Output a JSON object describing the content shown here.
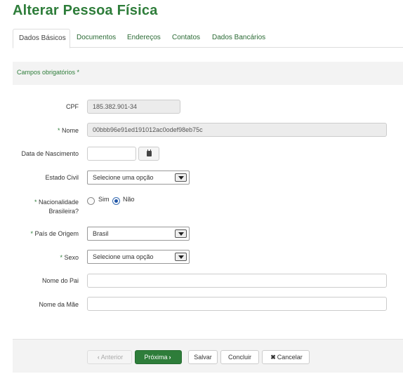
{
  "page": {
    "title": "Alterar Pessoa Física"
  },
  "tabs": [
    {
      "label": "Dados Básicos",
      "active": true
    },
    {
      "label": "Documentos"
    },
    {
      "label": "Endereços"
    },
    {
      "label": "Contatos"
    },
    {
      "label": "Dados Bancários"
    }
  ],
  "required_notice": "Campos obrigatórios *",
  "form": {
    "cpf": {
      "label": "CPF",
      "value": "185.382.901-34"
    },
    "nome": {
      "required_mark": "* ",
      "label": "Nome",
      "value": "00bbb96e91ed191012ac0odef98eb75c"
    },
    "data_nascimento": {
      "label": "Data de Nascimento",
      "value": ""
    },
    "estado_civil": {
      "label": "Estado Civil",
      "value": "Selecione uma opção"
    },
    "nacionalidade": {
      "required_mark": "* ",
      "label_line1": "Nacionalidade",
      "label_line2": "Brasileira?",
      "option_yes": "Sim",
      "option_no": "Não",
      "selected": "Não"
    },
    "pais_origem": {
      "required_mark": "* ",
      "label": "País de Origem",
      "value": "Brasil"
    },
    "sexo": {
      "required_mark": "* ",
      "label": "Sexo",
      "value": "Selecione uma opção"
    },
    "nome_pai": {
      "label": "Nome do Pai",
      "value": ""
    },
    "nome_mae": {
      "label": "Nome da Mãe",
      "value": ""
    }
  },
  "footer": {
    "anterior": {
      "icon": "‹",
      "label": "Anterior"
    },
    "proxima": {
      "label": "Próxima",
      "icon": "›"
    },
    "salvar": "Salvar",
    "concluir": "Concluir",
    "cancelar": {
      "icon": "✖",
      "label": "Cancelar"
    }
  },
  "colors": {
    "accent": "#2e7d3a"
  }
}
